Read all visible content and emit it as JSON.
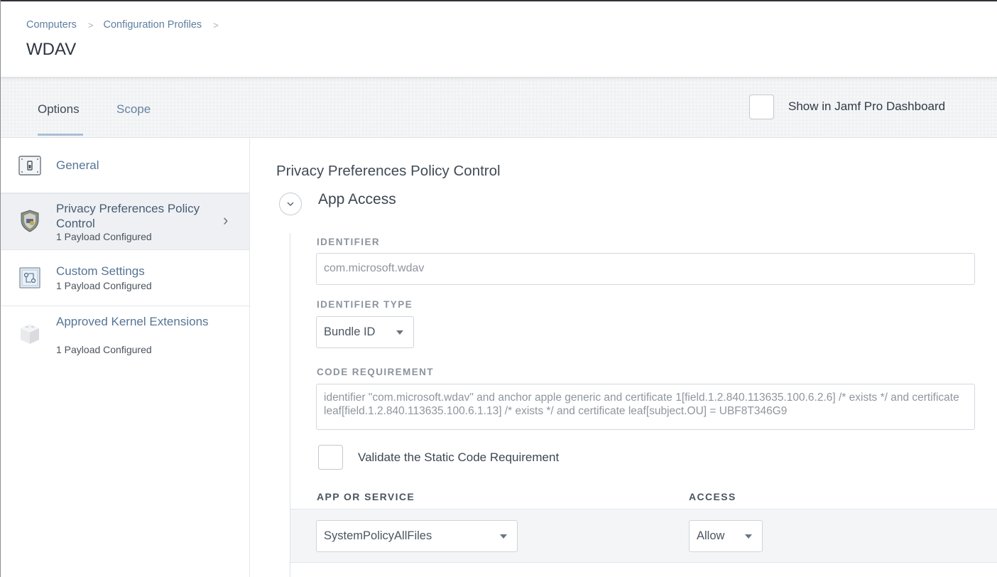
{
  "breadcrumb": {
    "items": [
      "Computers",
      "Configuration Profiles"
    ]
  },
  "page": {
    "title": "WDAV"
  },
  "tabs": {
    "options": "Options",
    "scope": "Scope",
    "active": "Options"
  },
  "dashboard": {
    "label": "Show in Jamf Pro Dashboard",
    "checked": false
  },
  "sidebar": {
    "items": [
      {
        "title": "General",
        "subtitle": "",
        "icon": "switch-panel-icon"
      },
      {
        "title": "Privacy Preferences Policy Control",
        "subtitle": "1 Payload Configured",
        "icon": "shield-icon",
        "active": true
      },
      {
        "title": "Custom Settings",
        "subtitle": "1 Payload Configured",
        "icon": "custom-settings-icon"
      },
      {
        "title": "Approved Kernel Extensions",
        "subtitle": "1 Payload Configured",
        "icon": "kernel-extension-cube-icon"
      }
    ]
  },
  "main": {
    "section_title": "Privacy Preferences Policy Control",
    "subsection_title": "App Access",
    "identifier": {
      "label": "IDENTIFIER",
      "value": "com.microsoft.wdav"
    },
    "identifier_type": {
      "label": "IDENTIFIER TYPE",
      "value": "Bundle ID"
    },
    "code_requirement": {
      "label": "CODE REQUIREMENT",
      "value": "identifier \"com.microsoft.wdav\" and anchor apple generic and certificate 1[field.1.2.840.113635.100.6.2.6] /* exists */ and certificate leaf[field.1.2.840.113635.100.6.1.13] /* exists */ and certificate leaf[subject.OU] = UBF8T346G9"
    },
    "validate": {
      "label": "Validate the Static Code Requirement",
      "checked": false
    },
    "table": {
      "col_service": "APP OR SERVICE",
      "col_access": "ACCESS",
      "service_value": "SystemPolicyAllFiles",
      "access_value": "Allow"
    }
  },
  "colors": {
    "link": "#5e7e9f",
    "tab_underline": "#a9bfd6",
    "active_item_bg": "#eef0f3"
  }
}
